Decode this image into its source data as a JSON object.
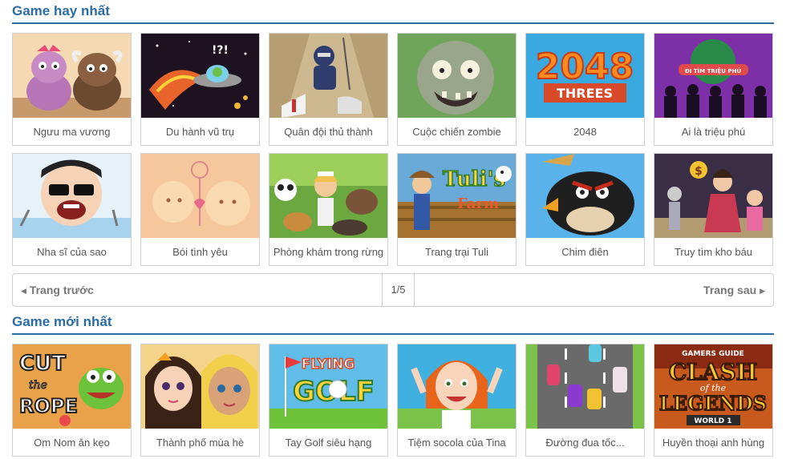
{
  "sections": {
    "top": {
      "title": "Game hay nhất"
    },
    "new": {
      "title": "Game mới nhất"
    }
  },
  "top_games": [
    {
      "name": "Ngưu ma vương"
    },
    {
      "name": "Du hành vũ trụ"
    },
    {
      "name": "Quân đội thủ thành"
    },
    {
      "name": "Cuộc chiến zombie"
    },
    {
      "name": "2048"
    },
    {
      "name": "Ai là triệu phú"
    },
    {
      "name": "Nha sĩ của sao"
    },
    {
      "name": "Bói tình yêu"
    },
    {
      "name": "Phòng khám trong rừng"
    },
    {
      "name": "Trang trại Tuli"
    },
    {
      "name": "Chim điên"
    },
    {
      "name": "Truy tìm kho báu"
    }
  ],
  "new_games": [
    {
      "name": "Om Nom ăn kẹo"
    },
    {
      "name": "Thành phố mùa hè"
    },
    {
      "name": "Tay Golf siêu hạng"
    },
    {
      "name": "Tiệm socola của Tina"
    },
    {
      "name": "Đường đua tốc..."
    },
    {
      "name": "Huyền thoại anh hùng"
    }
  ],
  "thumb_text": {
    "game_2048": "2048",
    "threes": "THREES",
    "millionaire": "ĐI TÌM TRIỆU PHÚ",
    "tuli": "Tuli's",
    "farm": "Farm",
    "cut": "CUT",
    "the": "the",
    "rope": "ROPE",
    "flying": "FLYING",
    "golf": "GOLF",
    "gamers_guide": "GAMERS GUIDE",
    "clash": "CLASH",
    "of_the": "of the",
    "legends": "LEGENDS",
    "world": "WORLD 1",
    "ufo_marks": "!?!"
  },
  "pager": {
    "prev": "Trang trước",
    "count": "1/5",
    "next": "Trang sau"
  },
  "icons": {
    "prev": "caret-left-icon",
    "next": "caret-right-icon"
  },
  "colors": {
    "accent": "#2b6ca3",
    "border": "#cfcfcf",
    "caption": "#555555"
  }
}
